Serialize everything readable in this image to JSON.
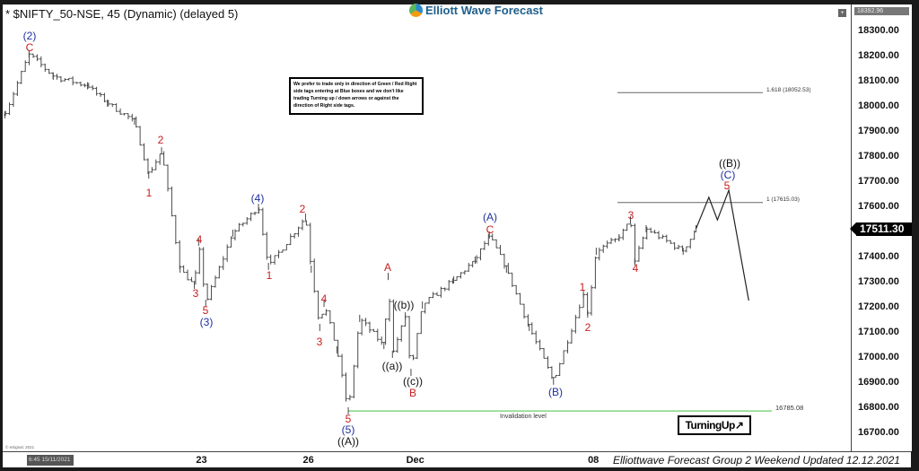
{
  "header": {
    "title": "* $NIFTY_50-NSE, 45 (Dynamic) (delayed 5)",
    "logo_text": "Elliott Wave Forecast"
  },
  "note": "We prefer to trade only in direction of Green / Red Right side tags entering at Blue boxes and we don't like trading Turning up / down arrows or against the direction of Right side tags.",
  "footer": {
    "text": "Elliottwave Forecast Group 2 Weekend Updated 12.12.2021",
    "cursor_date": "6:45 15/11/2021",
    "copyright": "© eSignal, 2021"
  },
  "badge": {
    "turning_up": "TurningUp",
    "icon": "arrow-up-right-icon"
  },
  "colors": {
    "red": "#c81e1e",
    "blue": "#1f2fa0",
    "black": "#111111",
    "invalidation": "#7fd67f",
    "bars": "#4a4a4a"
  },
  "chart_data": {
    "type": "ohlc",
    "symbol": "$NIFTY_50-NSE",
    "interval": "45",
    "ylim": [
      16640,
      18392.96
    ],
    "yticks": [
      "18300.00",
      "18200.00",
      "18100.00",
      "18000.00",
      "17900.00",
      "17800.00",
      "17700.00",
      "17600.00",
      "17500.00",
      "17400.00",
      "17300.00",
      "17200.00",
      "17100.00",
      "17000.00",
      "16900.00",
      "16800.00",
      "16700.00"
    ],
    "y_top_label": "18392.96",
    "last_price": "17511.30",
    "xticks": [
      {
        "label": "23",
        "date": "11-23"
      },
      {
        "label": "26",
        "date": "11-26"
      },
      {
        "label": "Dec",
        "date": "12-01"
      },
      {
        "label": "08",
        "date": "12-08"
      }
    ],
    "trading_days": [
      "11-12",
      "11-15",
      "11-16",
      "11-17",
      "11-18",
      "11-22",
      "11-23",
      "11-24",
      "11-25",
      "11-26",
      "11-29",
      "11-30",
      "12-01",
      "12-02",
      "12-03",
      "12-06",
      "12-07",
      "12-08",
      "12-09",
      "12-10",
      "12-13",
      "12-14"
    ],
    "price_path": [
      [
        "11-12 12:15",
        17964
      ],
      [
        "11-15 10:15",
        18207
      ],
      [
        "11-15 14:30",
        18118
      ],
      [
        "11-16 14:15",
        18080
      ],
      [
        "11-17 11:30",
        18011
      ],
      [
        "11-18 10:00",
        17939
      ],
      [
        "11-18 12:30",
        17725
      ],
      [
        "11-18 14:45",
        17821
      ],
      [
        "11-22 11:45",
        17350
      ],
      [
        "11-22 14:15",
        17286
      ],
      [
        "11-22 15:00",
        17457
      ],
      [
        "11-23 10:00",
        17214
      ],
      [
        "11-23 14:45",
        17493
      ],
      [
        "11-24 13:00",
        17596
      ],
      [
        "11-24 14:45",
        17361
      ],
      [
        "11-25 15:00",
        17557
      ],
      [
        "11-26 09:45",
        17350
      ],
      [
        "11-26 11:15",
        17118
      ],
      [
        "11-26 12:00",
        17214
      ],
      [
        "11-26 14:15",
        17029
      ],
      [
        "11-29 10:00",
        16786
      ],
      [
        "11-29 12:00",
        17154
      ],
      [
        "11-30 10:00",
        17046
      ],
      [
        "11-30 10:45",
        17321
      ],
      [
        "11-30 11:30",
        17011
      ],
      [
        "11-30 13:45",
        17164
      ],
      [
        "11-30 14:45",
        16939
      ],
      [
        "12-01 10:30",
        17207
      ],
      [
        "12-02 09:45",
        17307
      ],
      [
        "12-02 13:30",
        17386
      ],
      [
        "12-03 09:45",
        17486
      ],
      [
        "12-03 12:45",
        17350
      ],
      [
        "12-06 10:30",
        17118
      ],
      [
        "12-06 14:45",
        16904
      ],
      [
        "12-07 13:45",
        17250
      ],
      [
        "12-07 14:30",
        17171
      ],
      [
        "12-08 09:45",
        17421
      ],
      [
        "12-08 13:45",
        17475
      ],
      [
        "12-09 09:30",
        17546
      ],
      [
        "12-09 10:15",
        17379
      ],
      [
        "12-09 12:15",
        17511
      ],
      [
        "12-10 12:30",
        17421
      ],
      [
        "12-10 14:45",
        17511
      ]
    ],
    "projection": [
      [
        "12-10 14:45",
        17511
      ],
      [
        "12-13 10:45",
        17636
      ],
      [
        "12-13 12:15",
        17546
      ],
      [
        "12-13 14:15",
        17664
      ],
      [
        "12-14 11:30",
        17225
      ]
    ],
    "levels": [
      {
        "label": "1.618 (18052.53)",
        "price": 18052.53,
        "color": "#555555"
      },
      {
        "label": "1 (17615.03)",
        "price": 17615.03,
        "color": "#555555"
      },
      {
        "label": "16785.08",
        "price": 16785.08,
        "color": "#7fd67f",
        "caption": "Invalidation level"
      }
    ],
    "wave_labels": [
      {
        "text": "(2)",
        "color": "blue"
      },
      {
        "text": "C",
        "color": "red"
      },
      {
        "text": "1",
        "color": "red"
      },
      {
        "text": "2",
        "color": "red"
      },
      {
        "text": "4",
        "color": "red"
      },
      {
        "text": "3",
        "color": "red"
      },
      {
        "text": "5",
        "color": "red"
      },
      {
        "text": "(3)",
        "color": "blue"
      },
      {
        "text": "(4)",
        "color": "blue"
      },
      {
        "text": "1",
        "color": "red"
      },
      {
        "text": "2",
        "color": "red"
      },
      {
        "text": "4",
        "color": "red"
      },
      {
        "text": "3",
        "color": "red"
      },
      {
        "text": "5",
        "color": "red"
      },
      {
        "text": "(5)",
        "color": "blue"
      },
      {
        "text": "((A))",
        "color": "black"
      },
      {
        "text": "A",
        "color": "red"
      },
      {
        "text": "((b))",
        "color": "black"
      },
      {
        "text": "((a))",
        "color": "black"
      },
      {
        "text": "((c))",
        "color": "black"
      },
      {
        "text": "B",
        "color": "red"
      },
      {
        "text": "(A)",
        "color": "blue"
      },
      {
        "text": "C",
        "color": "red"
      },
      {
        "text": "(B)",
        "color": "blue"
      },
      {
        "text": "1",
        "color": "red"
      },
      {
        "text": "2",
        "color": "red"
      },
      {
        "text": "3",
        "color": "red"
      },
      {
        "text": "4",
        "color": "red"
      },
      {
        "text": "((B))",
        "color": "black"
      },
      {
        "text": "(C)",
        "color": "blue"
      },
      {
        "text": "5",
        "color": "red"
      }
    ]
  }
}
